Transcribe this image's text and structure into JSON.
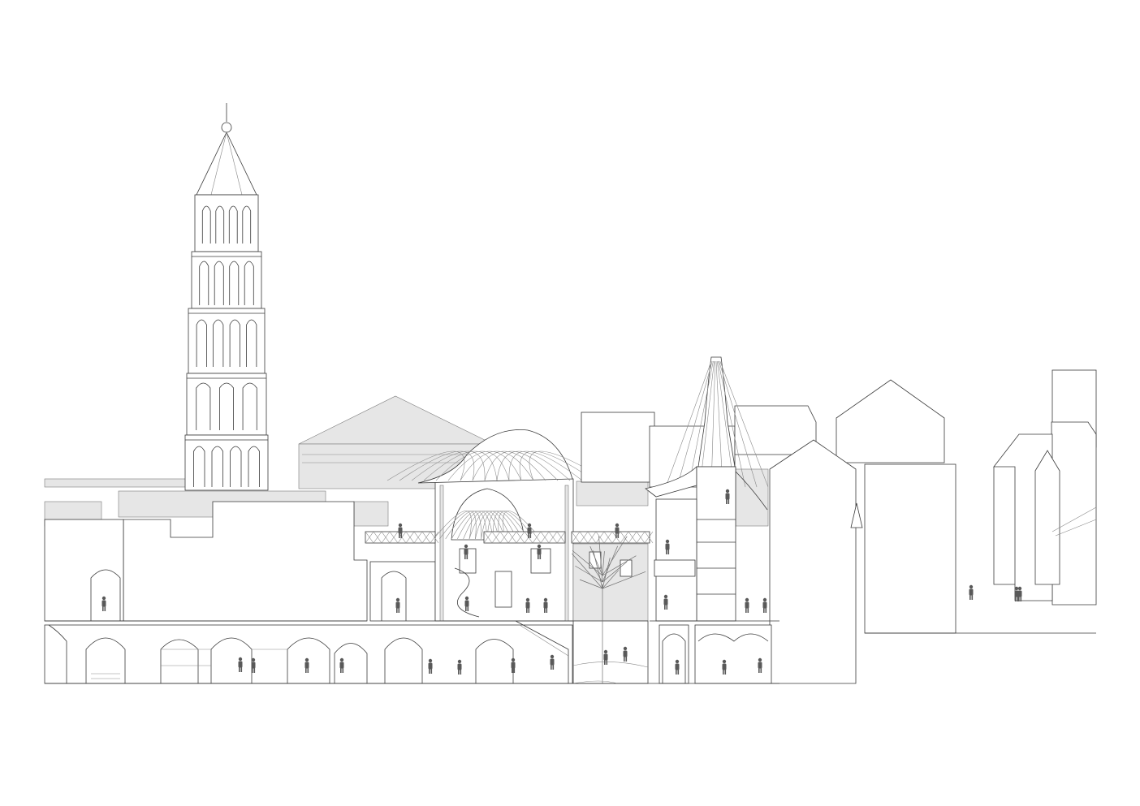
{
  "drawing": {
    "kind": "architectural-section-elevation",
    "palette": {
      "line": "#3a3a3a",
      "light_line": "#8a8a8a",
      "fill_light": "#e6e6e6",
      "fill_mid": "#d7d7d7",
      "figure": "#595959",
      "background": "#ffffff"
    }
  }
}
